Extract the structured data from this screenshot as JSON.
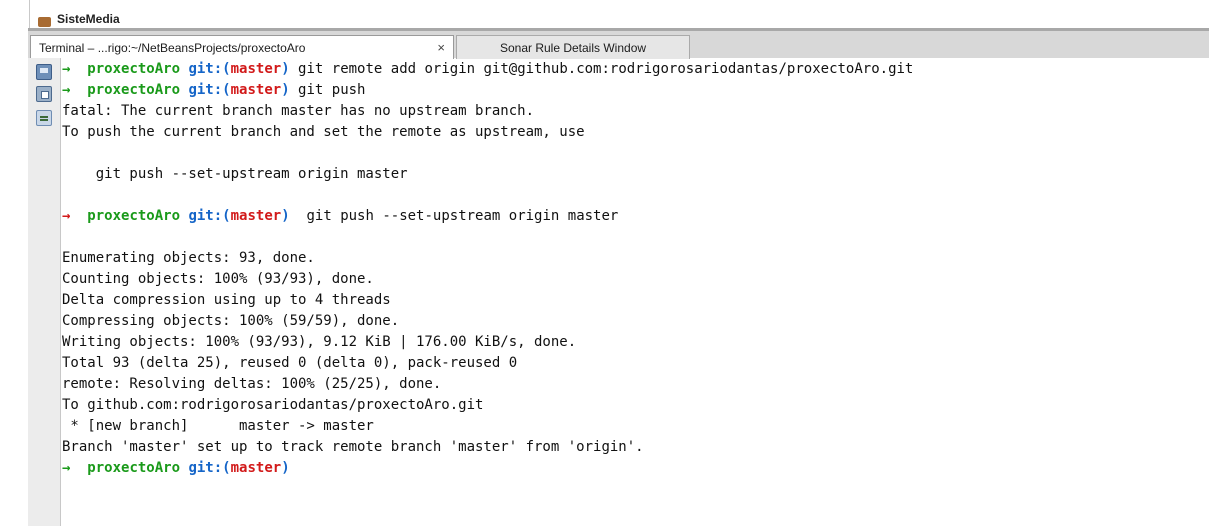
{
  "project_tree": {
    "node_label": "SisteMedia"
  },
  "tabs": [
    {
      "label": "Terminal – ...rigo:~/NetBeansProjects/proxectoAro",
      "close": "×",
      "active": true
    },
    {
      "label": "Sonar Rule Details Window",
      "active": false
    }
  ],
  "prompt": {
    "arrow": "→",
    "dir": "proxectoAro",
    "git": "git:(",
    "branch": "master",
    "git_close": ")"
  },
  "terminal": {
    "lines": [
      {
        "type": "prompt",
        "arrow_color": "green",
        "cmd": " git remote add origin git@github.com:rodrigorosariodantas/proxectoAro.git"
      },
      {
        "type": "prompt",
        "arrow_color": "green",
        "cmd": " git push"
      },
      {
        "type": "text",
        "text": "fatal: The current branch master has no upstream branch."
      },
      {
        "type": "text",
        "text": "To push the current branch and set the remote as upstream, use"
      },
      {
        "type": "text",
        "text": ""
      },
      {
        "type": "text",
        "text": "    git push --set-upstream origin master"
      },
      {
        "type": "text",
        "text": ""
      },
      {
        "type": "prompt",
        "arrow_color": "red",
        "cmd": "  git push --set-upstream origin master"
      },
      {
        "type": "text",
        "text": ""
      },
      {
        "type": "text",
        "text": "Enumerating objects: 93, done."
      },
      {
        "type": "text",
        "text": "Counting objects: 100% (93/93), done."
      },
      {
        "type": "text",
        "text": "Delta compression using up to 4 threads"
      },
      {
        "type": "text",
        "text": "Compressing objects: 100% (59/59), done."
      },
      {
        "type": "text",
        "text": "Writing objects: 100% (93/93), 9.12 KiB | 176.00 KiB/s, done."
      },
      {
        "type": "text",
        "text": "Total 93 (delta 25), reused 0 (delta 0), pack-reused 0"
      },
      {
        "type": "text",
        "text": "remote: Resolving deltas: 100% (25/25), done."
      },
      {
        "type": "text",
        "text": "To github.com:rodrigorosariodantas/proxectoAro.git"
      },
      {
        "type": "text",
        "text": " * [new branch]      master -> master"
      },
      {
        "type": "text",
        "text": "Branch 'master' set up to track remote branch 'master' from 'origin'."
      },
      {
        "type": "prompt",
        "arrow_color": "green",
        "cmd": ""
      }
    ]
  },
  "side_toolbar": {
    "icons": [
      "terminal-icon",
      "new-tab-icon",
      "clear-icon"
    ]
  }
}
